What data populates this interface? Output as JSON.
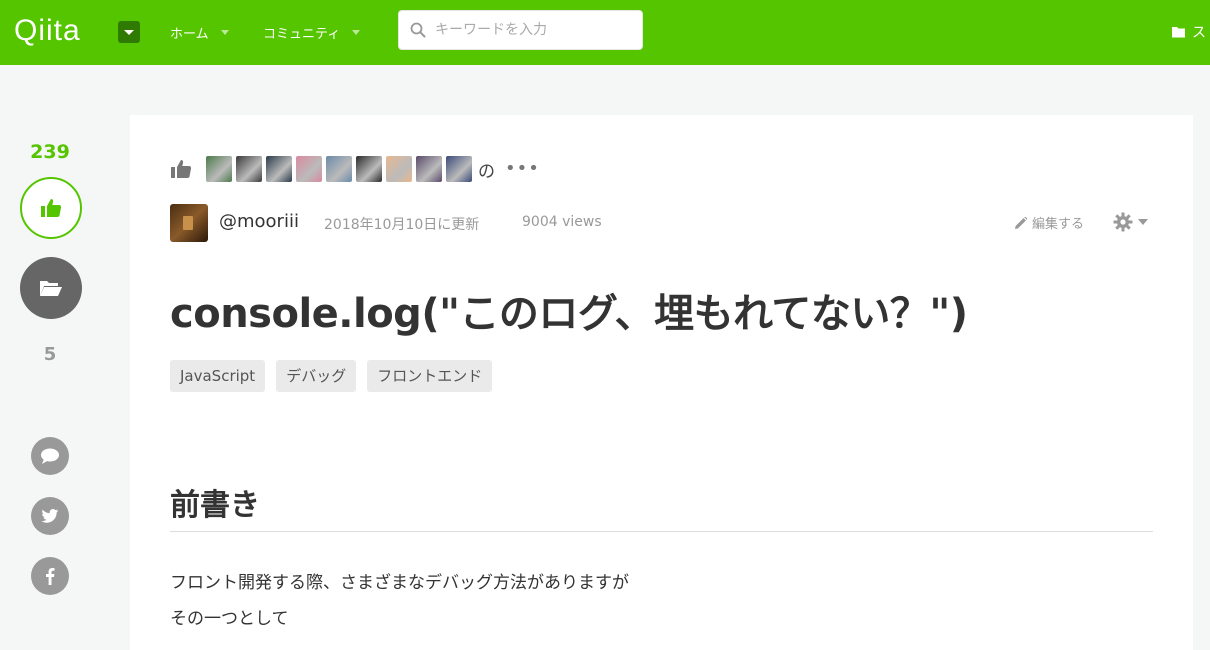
{
  "header": {
    "logo": "Qiita",
    "nav_home": "ホーム",
    "nav_community": "コミュニティ",
    "search_placeholder": "キーワードを入力",
    "right_label": "ス"
  },
  "sidebar": {
    "like_count": "239",
    "comment_count": "5"
  },
  "article": {
    "liked_by_suffix": "の",
    "more": "•••",
    "author": "@mooriii",
    "updated": "2018年10月10日に更新",
    "views": "9004 views",
    "edit_label": "編集する",
    "title": "console.log(\"このログ、埋もれてない？\")",
    "tags": [
      "JavaScript",
      "デバッグ",
      "フロントエンド"
    ],
    "heading": "前書き",
    "paragraphs": [
      "フロント開発する際、さまざまなデバッグ方法がありますが",
      "その一つとして"
    ]
  },
  "colors": {
    "brand": "#55c500",
    "brand_dark": "#2f7a00"
  },
  "liker_avatars": [
    "#4a7a4a",
    "#3a3a3a",
    "#2a3a4a",
    "#d98aa0",
    "#6a8aa8",
    "#2a2a2a",
    "#e8b890",
    "#5a4a6a",
    "#3a4a7a"
  ]
}
